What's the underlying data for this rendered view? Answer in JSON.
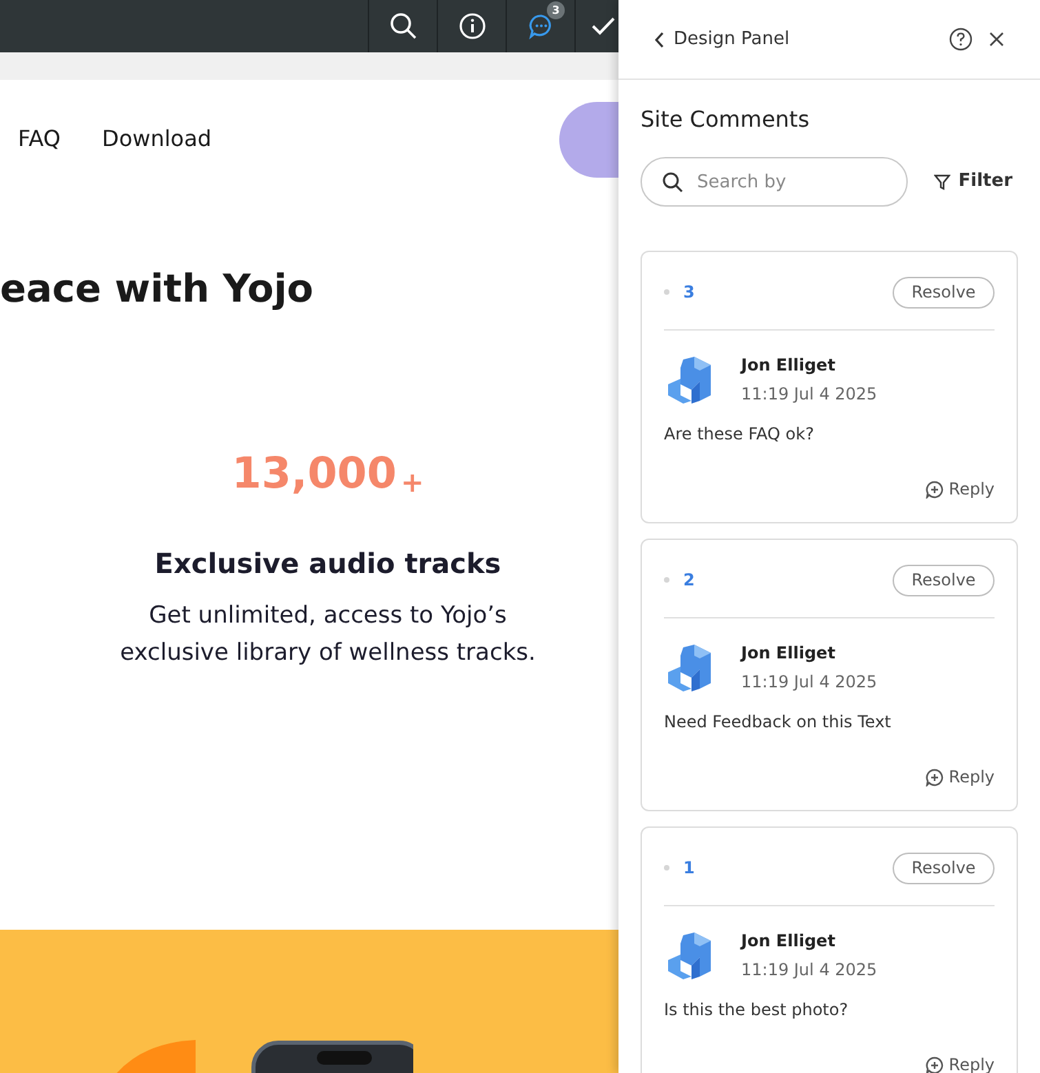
{
  "toolbar": {
    "buttons": [
      {
        "kind": "search"
      },
      {
        "kind": "info"
      },
      {
        "kind": "comments",
        "badge": "3"
      },
      {
        "kind": "check"
      }
    ]
  },
  "site": {
    "nav_links": [
      "FAQ",
      "Download"
    ],
    "heading": "eace with Yojo",
    "stat": {
      "value": "13,000",
      "suffix": "+"
    },
    "feature_title": "Exclusive audio tracks",
    "feature_text": "Get unlimited, access to Yojo’s exclusive library of wellness tracks."
  },
  "panel": {
    "back_label": "Design Panel",
    "title": "Site Comments",
    "search": {
      "placeholder": "Search by"
    },
    "filter_label": "Filter",
    "comments": [
      {
        "number": "3",
        "resolve_label": "Resolve",
        "author": "Jon Elliget",
        "time": "11:19 Jul 4 2025",
        "text": "Are these FAQ ok?",
        "reply_label": "Reply"
      },
      {
        "number": "2",
        "resolve_label": "Resolve",
        "author": "Jon Elliget",
        "time": "11:19 Jul 4 2025",
        "text": "Need Feedback on this Text",
        "reply_label": "Reply"
      },
      {
        "number": "1",
        "resolve_label": "Resolve",
        "author": "Jon Elliget",
        "time": "11:19 Jul 4 2025",
        "text": "Is this the best photo?",
        "reply_label": "Reply"
      }
    ]
  }
}
